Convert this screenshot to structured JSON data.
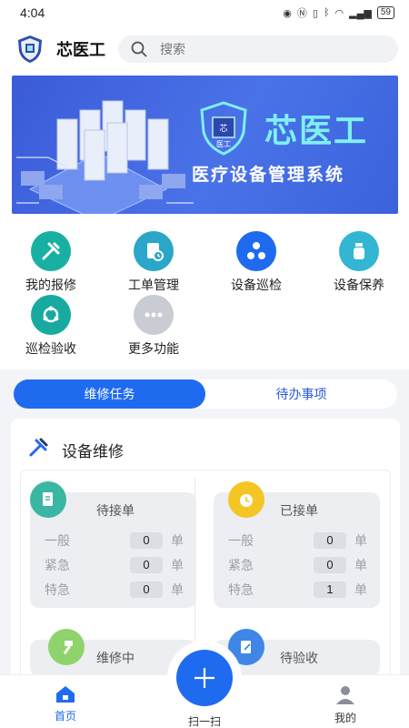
{
  "status_bar": {
    "time": "4:04",
    "battery": "59"
  },
  "header": {
    "app_title": "芯医工",
    "search_placeholder": "搜索"
  },
  "banner": {
    "title": "芯医工",
    "subtitle": "医疗设备管理系统",
    "logo_text": "芯医工"
  },
  "functions": [
    {
      "label": "我的报修",
      "icon": "tools-icon",
      "color": "#18b0a3"
    },
    {
      "label": "工单管理",
      "icon": "clipboard-clock-icon",
      "color": "#2aa6c8"
    },
    {
      "label": "设备巡检",
      "icon": "network-icon",
      "color": "#1e6bf0"
    },
    {
      "label": "设备保养",
      "icon": "bottle-icon",
      "color": "#32b6d4"
    },
    {
      "label": "巡检验收",
      "icon": "cycle-icon",
      "color": "#18aaa0"
    },
    {
      "label": "更多功能",
      "icon": "more-icon",
      "color": "#c9ccd2"
    }
  ],
  "tabs": [
    {
      "label": "维修任务",
      "active": true
    },
    {
      "label": "待办事项",
      "active": false
    }
  ],
  "repair_card": {
    "title": "设备维修",
    "panels": [
      {
        "title": "待接单",
        "icon": "document-icon",
        "rows": [
          {
            "label": "一般",
            "value": "0",
            "unit": "单"
          },
          {
            "label": "紧急",
            "value": "0",
            "unit": "单"
          },
          {
            "label": "特急",
            "value": "0",
            "unit": "单"
          }
        ]
      },
      {
        "title": "已接单",
        "icon": "alarm-clock-icon",
        "rows": [
          {
            "label": "一般",
            "value": "0",
            "unit": "单"
          },
          {
            "label": "紧急",
            "value": "0",
            "unit": "单"
          },
          {
            "label": "特急",
            "value": "1",
            "unit": "单"
          }
        ]
      },
      {
        "title": "维修中",
        "icon": "hammer-icon"
      },
      {
        "title": "待验收",
        "icon": "edit-document-icon"
      }
    ]
  },
  "bottom_nav": {
    "home": "首页",
    "scan": "扫一扫",
    "mine": "我的"
  },
  "colors": {
    "primary": "#1e6bf0",
    "accent_cyan": "#7ef0f2"
  }
}
